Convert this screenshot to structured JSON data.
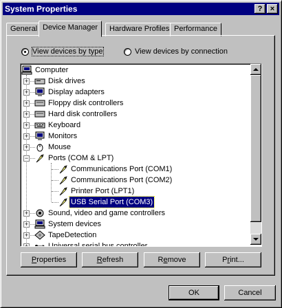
{
  "window": {
    "title": "System Properties",
    "help_button": "?",
    "close_button": "×"
  },
  "tabs": [
    {
      "label": "General"
    },
    {
      "label": "Device Manager",
      "active": true
    },
    {
      "label": "Hardware Profiles"
    },
    {
      "label": "Performance"
    }
  ],
  "view_options": {
    "by_type": {
      "label": "View devices by type",
      "selected": true
    },
    "by_connection": {
      "label": "View devices by connection",
      "selected": false
    }
  },
  "tree": {
    "root": "Computer",
    "items": [
      {
        "label": "Disk drives",
        "icon": "disk-drive-icon",
        "expand": "+"
      },
      {
        "label": "Display adapters",
        "icon": "display-adapter-icon",
        "expand": "+"
      },
      {
        "label": "Floppy disk controllers",
        "icon": "floppy-controller-icon",
        "expand": "+"
      },
      {
        "label": "Hard disk controllers",
        "icon": "hard-disk-controller-icon",
        "expand": "+"
      },
      {
        "label": "Keyboard",
        "icon": "keyboard-icon",
        "expand": "+"
      },
      {
        "label": "Monitors",
        "icon": "monitor-icon",
        "expand": "+"
      },
      {
        "label": "Mouse",
        "icon": "mouse-icon",
        "expand": "+"
      },
      {
        "label": "Ports (COM & LPT)",
        "icon": "port-icon",
        "expand": "−"
      },
      {
        "label": "Communications Port (COM1)",
        "icon": "port-icon",
        "child": true
      },
      {
        "label": "Communications Port (COM2)",
        "icon": "port-icon",
        "child": true
      },
      {
        "label": "Printer Port (LPT1)",
        "icon": "port-icon",
        "child": true
      },
      {
        "label": "USB Serial Port (COM3)",
        "icon": "port-icon",
        "child": true,
        "selected": true
      },
      {
        "label": "Sound, video and game controllers",
        "icon": "sound-icon",
        "expand": "+"
      },
      {
        "label": "System devices",
        "icon": "system-devices-icon",
        "expand": "+"
      },
      {
        "label": "TapeDetection",
        "icon": "tape-icon",
        "expand": "+"
      },
      {
        "label": "Universal serial bus controller",
        "icon": "usb-icon",
        "expand": "+"
      }
    ]
  },
  "buttons": {
    "properties": {
      "label": "Properties",
      "mnemonic_index": 0
    },
    "refresh": {
      "label": "Refresh",
      "mnemonic_index": 0
    },
    "remove": {
      "label": "Remove",
      "mnemonic_index": 1
    },
    "print": {
      "label": "Print...",
      "mnemonic_index": 1
    },
    "ok": {
      "label": "OK"
    },
    "cancel": {
      "label": "Cancel"
    }
  },
  "colors": {
    "titlebar": "#000080",
    "selection": "#000080",
    "face": "#c0c0c0"
  }
}
